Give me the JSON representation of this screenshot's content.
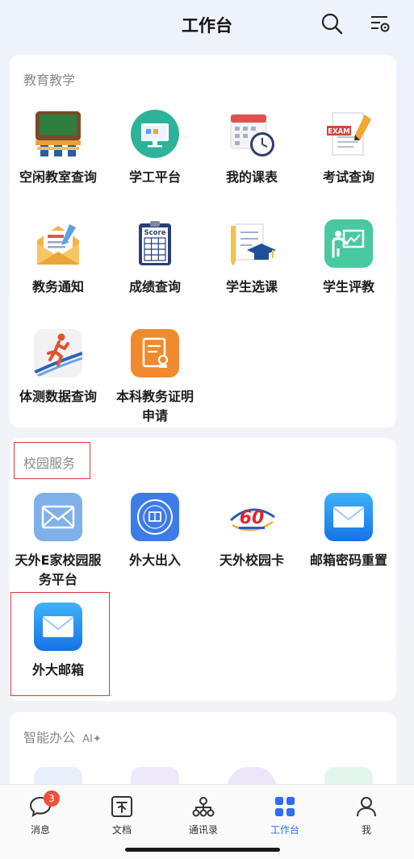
{
  "header": {
    "title": "工作台"
  },
  "education": {
    "title": "教育教学",
    "items": [
      {
        "label": "空闲教室查询"
      },
      {
        "label": "学工平台"
      },
      {
        "label": "我的课表"
      },
      {
        "label": "考试查询"
      },
      {
        "label": "教务通知"
      },
      {
        "label": "成绩查询"
      },
      {
        "label": "学生选课"
      },
      {
        "label": "学生评教"
      },
      {
        "label": "体测数据查询"
      },
      {
        "label": "本科教务证明申请"
      }
    ],
    "exam_badge": "EXAM",
    "score_badge": "Score"
  },
  "campus": {
    "title": "校园服务",
    "items": [
      {
        "label": "天外E家校园服务平台"
      },
      {
        "label": "外大出入"
      },
      {
        "label": "天外校园卡"
      },
      {
        "label": "邮箱密码重置"
      },
      {
        "label": "外大邮箱"
      }
    ],
    "card_logo_text": "60"
  },
  "office": {
    "title": "智能办公",
    "ai_tag": "AI✦"
  },
  "tabbar": {
    "tabs": [
      {
        "label": "消息",
        "badge": "3"
      },
      {
        "label": "文档"
      },
      {
        "label": "通讯录"
      },
      {
        "label": "工作台"
      },
      {
        "label": "我"
      }
    ]
  },
  "colors": {
    "accent": "#2e6df6",
    "highlight_box": "#e0373a",
    "badge": "#f04d3d"
  }
}
